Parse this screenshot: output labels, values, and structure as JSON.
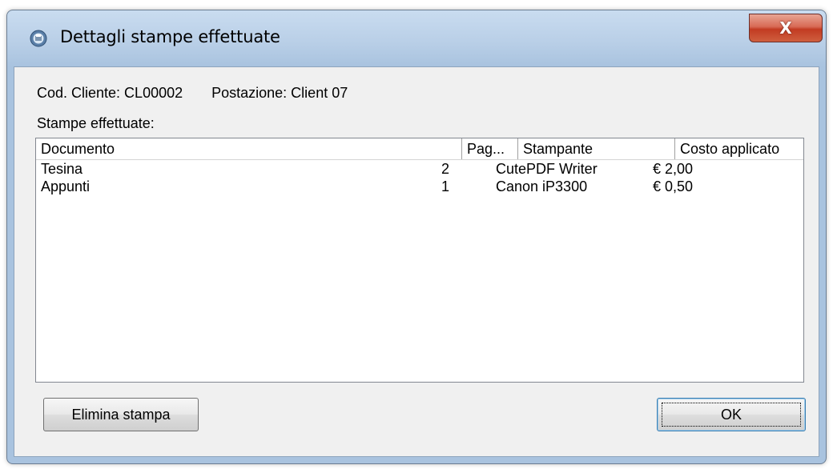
{
  "window": {
    "title": "Dettagli stampe effettuate",
    "close_glyph": "X"
  },
  "info": {
    "client_code": "Cod. Cliente: CL00002",
    "station": "Postazione: Client 07",
    "prints_label": "Stampe effettuate:"
  },
  "table": {
    "columns": [
      "Documento",
      "Pag...",
      "Stampante",
      "Costo applicato"
    ],
    "rows": [
      [
        "Tesina",
        "2",
        "CutePDF Writer",
        "€ 2,00"
      ],
      [
        "Appunti",
        "1",
        "Canon iP3300",
        "€ 0,50"
      ]
    ]
  },
  "buttons": {
    "delete_label": "Elimina stampa",
    "ok_label": "OK"
  },
  "icons": {
    "app": "printer-globe-icon",
    "close": "close-icon"
  }
}
